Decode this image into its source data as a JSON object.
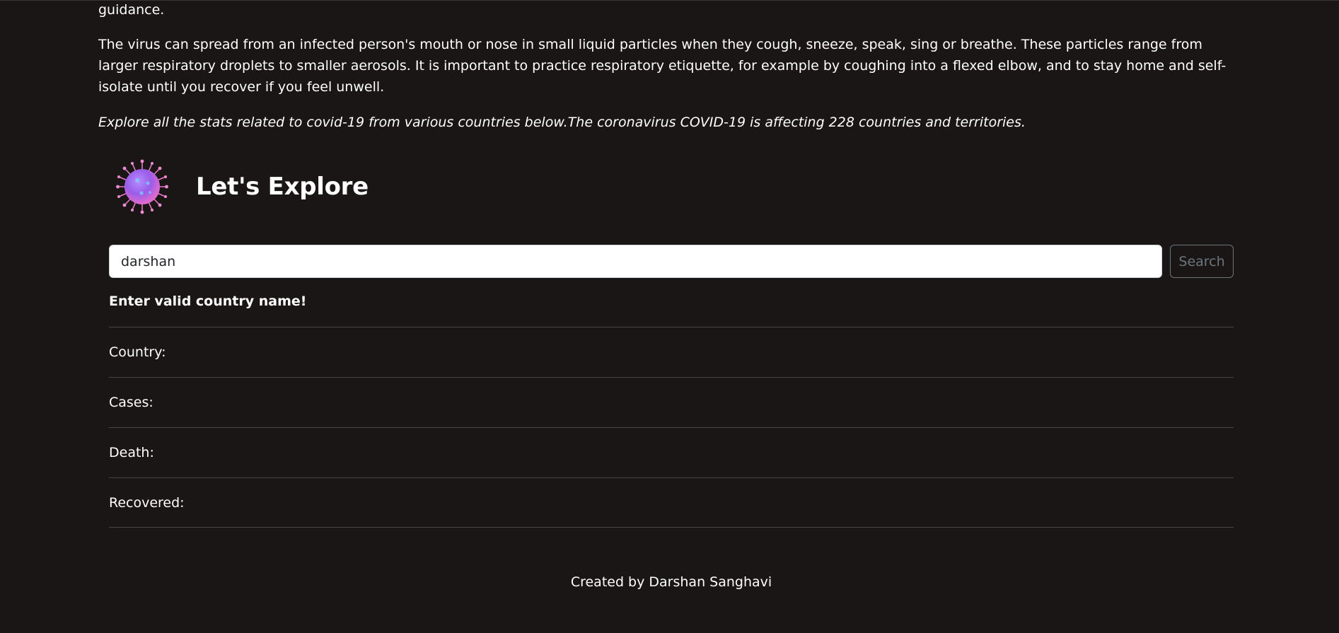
{
  "intro": {
    "guidance_tail": "guidance.",
    "virus_paragraph": "The virus can spread from an infected person's mouth or nose in small liquid particles when they cough, sneeze, speak, sing or breathe. These particles range from larger respiratory droplets to smaller aerosols. It is important to practice respiratory etiquette, for example by coughing into a flexed elbow, and to stay home and self-isolate until you recover if you feel unwell.",
    "explore_note": "Explore all the stats related to covid-19 from various countries below.The coronavirus COVID-19 is affecting 228 countries and territories."
  },
  "explore": {
    "logo_icon": "virus-icon",
    "title": "Let's Explore"
  },
  "search": {
    "value": "darshan",
    "button_label": "Search"
  },
  "error": "Enter valid country name!",
  "stats": [
    {
      "label": "Country:",
      "value": ""
    },
    {
      "label": "Cases:",
      "value": ""
    },
    {
      "label": "Death:",
      "value": ""
    },
    {
      "label": "Recovered:",
      "value": ""
    }
  ],
  "footer": "Created by Darshan Sanghavi",
  "colors": {
    "background": "#1b1616",
    "text": "#ffffff",
    "button_outline": "#6c757d",
    "divider": "#4a4545"
  }
}
